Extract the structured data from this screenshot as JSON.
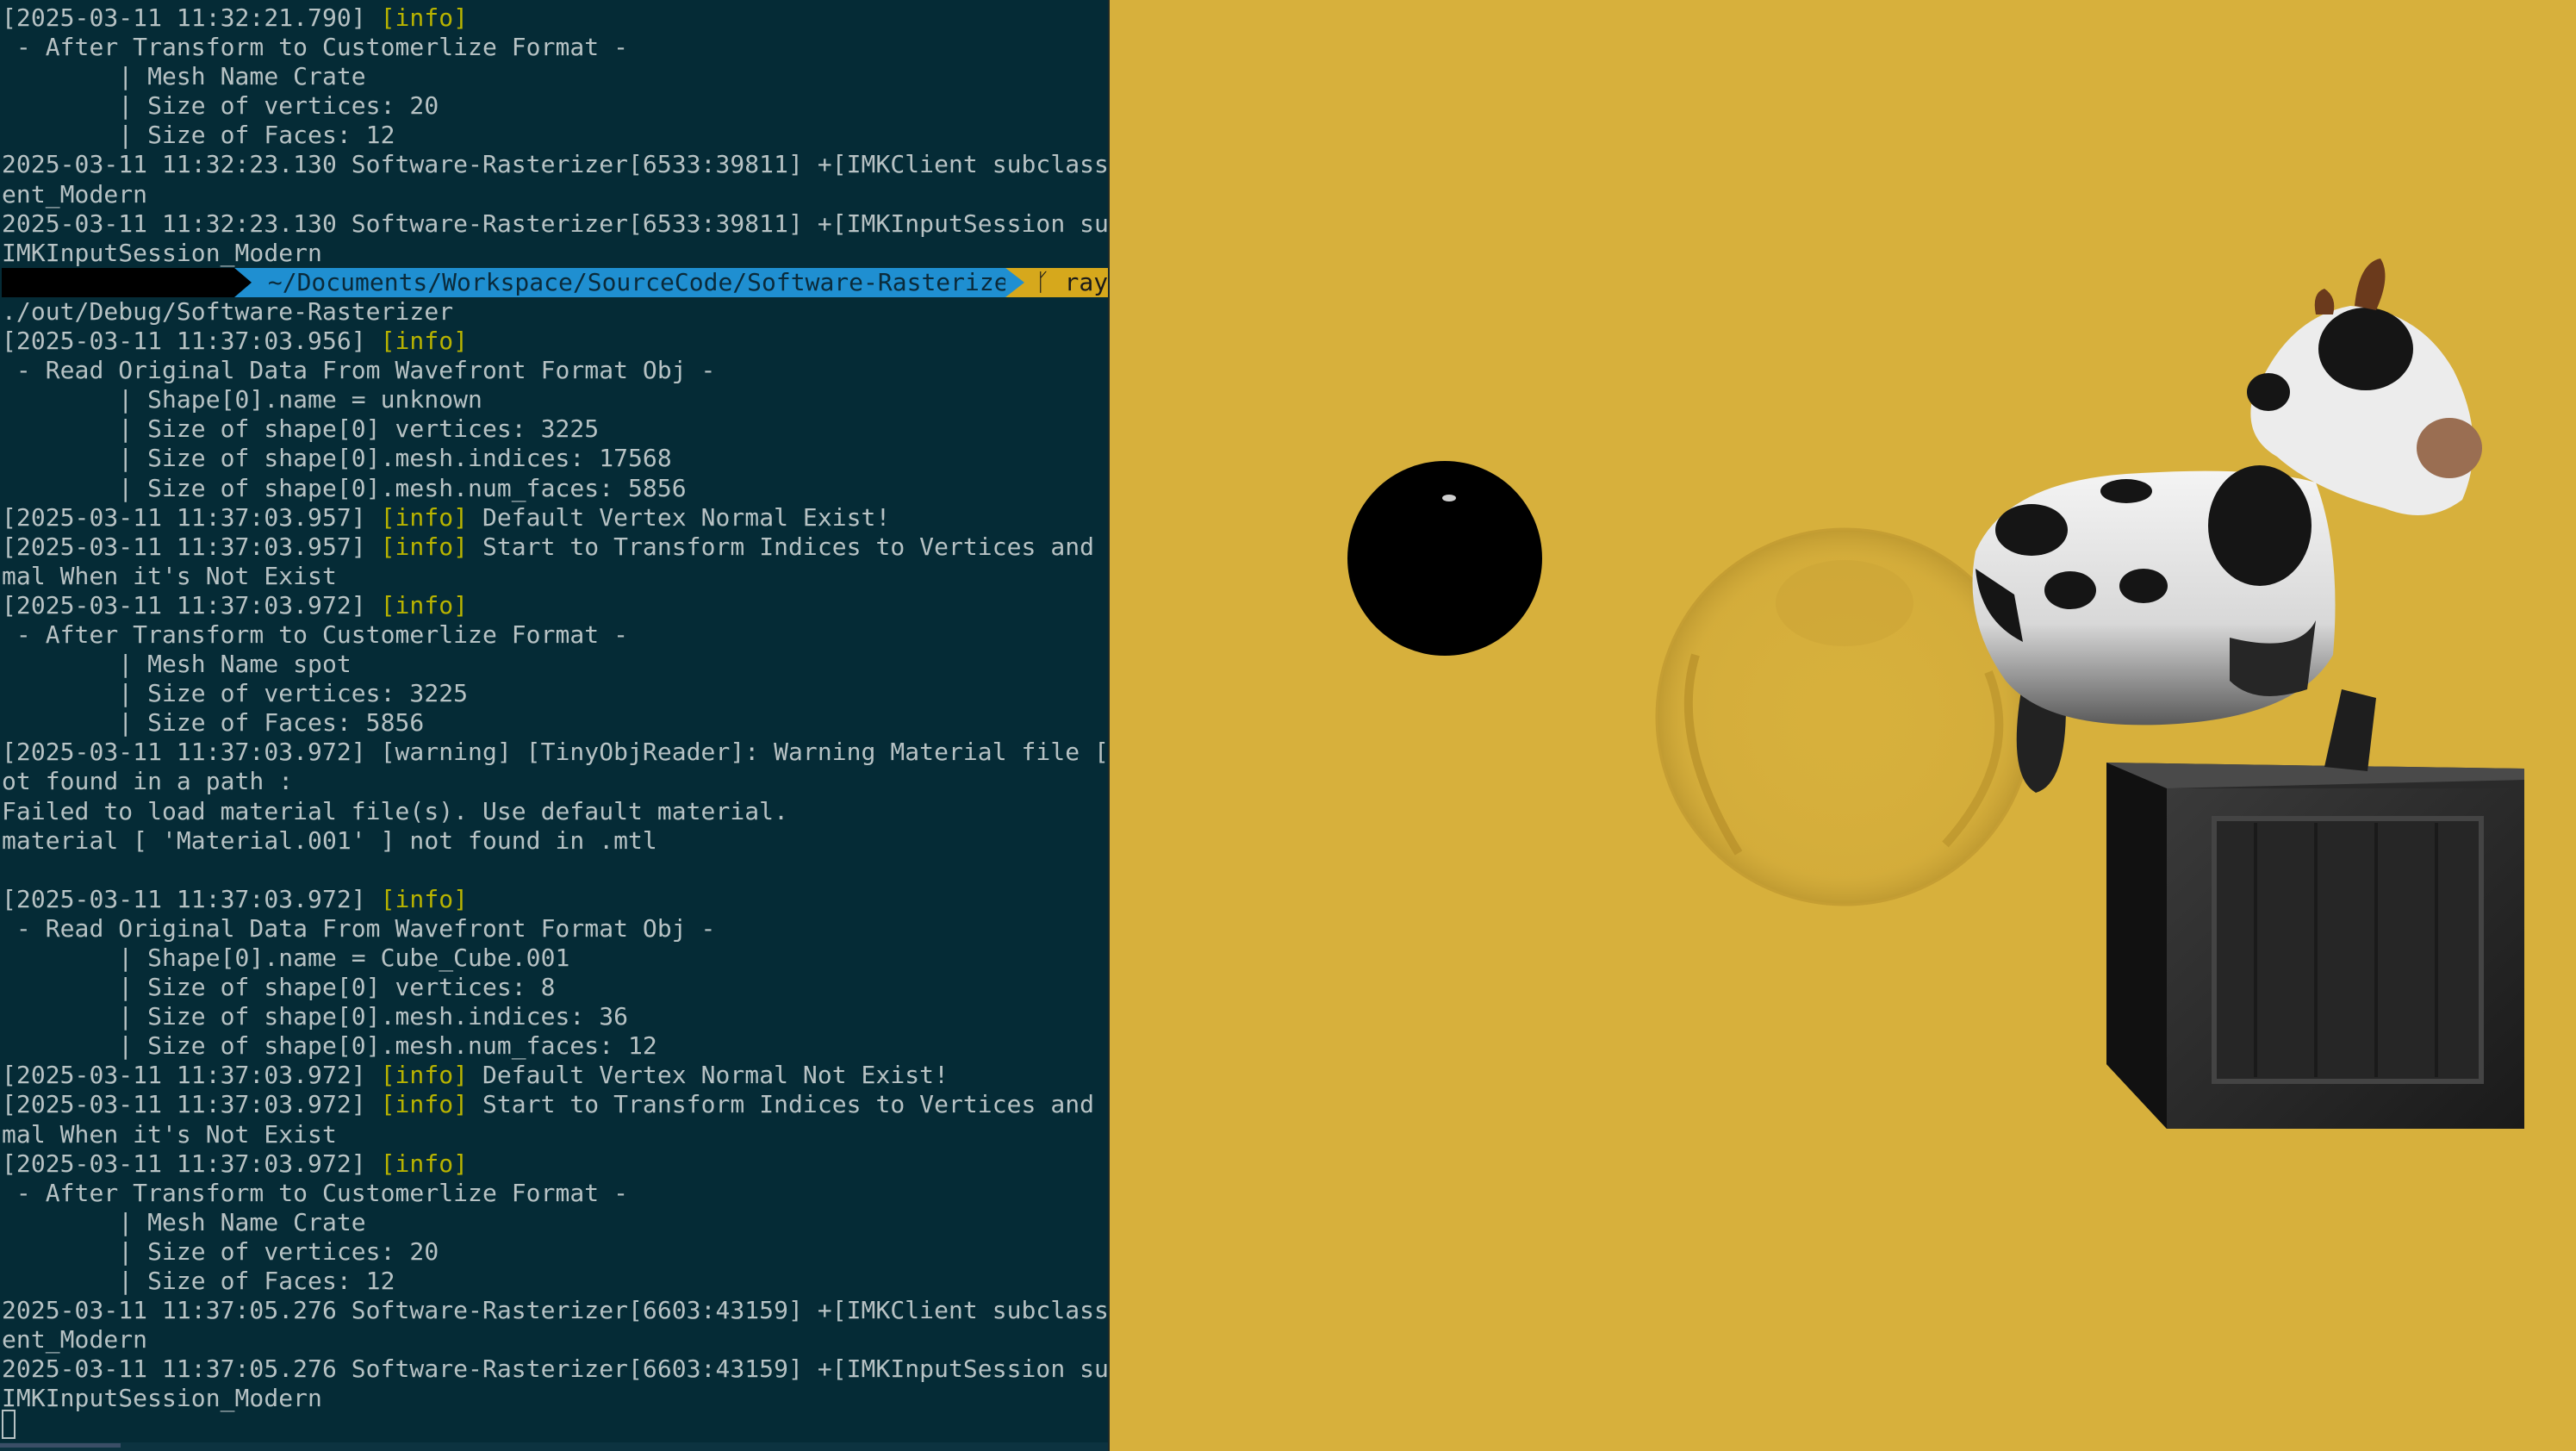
{
  "terminal": {
    "lines_top": [
      {
        "t": "[2025-03-11 11:32:21.790] ",
        "info": "[info]"
      },
      {
        "t": " - After Transform to Customerlize Format -"
      },
      {
        "t": "        | Mesh Name Crate"
      },
      {
        "t": "        | Size of vertices: 20"
      },
      {
        "t": "        | Size of Faces: 12"
      },
      {
        "t": "2025-03-11 11:32:23.130 Software-Rasterizer[6533:39811] +[IMKClient subclass]: ch"
      },
      {
        "t": "ent_Modern"
      },
      {
        "t": "2025-03-11 11:32:23.130 Software-Rasterizer[6533:39811] +[IMKInputSession subcla"
      },
      {
        "t": "IMKInputSession_Modern"
      }
    ],
    "prompt": {
      "path": " ~/Documents/Workspace/SourceCode/Software-Rasterizer ",
      "branch": " ᚴ rayt"
    },
    "lines_bottom": [
      {
        "t": "./out/Debug/Software-Rasterizer"
      },
      {
        "t": "[2025-03-11 11:37:03.956] ",
        "info": "[info]"
      },
      {
        "t": " - Read Original Data From Wavefront Format Obj -"
      },
      {
        "t": "        | Shape[0].name = unknown"
      },
      {
        "t": "        | Size of shape[0] vertices: 3225"
      },
      {
        "t": "        | Size of shape[0].mesh.indices: 17568"
      },
      {
        "t": "        | Size of shape[0].mesh.num_faces: 5856"
      },
      {
        "t": "[2025-03-11 11:37:03.957] ",
        "info": "[info]",
        "rest": " Default Vertex Normal Exist!"
      },
      {
        "t": "[2025-03-11 11:37:03.957] ",
        "info": "[info]",
        "rest": " Start to Transform Indices to Vertices and Calc"
      },
      {
        "t": "mal When it's Not Exist"
      },
      {
        "t": "[2025-03-11 11:37:03.972] ",
        "info": "[info]"
      },
      {
        "t": " - After Transform to Customerlize Format -"
      },
      {
        "t": "        | Mesh Name spot"
      },
      {
        "t": "        | Size of vertices: 3225"
      },
      {
        "t": "        | Size of Faces: 5856"
      },
      {
        "t": "[2025-03-11 11:37:03.972] [warning] [TinyObjReader]: Warning Material file [ Cra"
      },
      {
        "t": "ot found in a path :"
      },
      {
        "t": "Failed to load material file(s). Use default material."
      },
      {
        "t": "material [ 'Material.001' ] not found in .mtl"
      },
      {
        "t": ""
      },
      {
        "t": "[2025-03-11 11:37:03.972] ",
        "info": "[info]"
      },
      {
        "t": " - Read Original Data From Wavefront Format Obj -"
      },
      {
        "t": "        | Shape[0].name = Cube_Cube.001"
      },
      {
        "t": "        | Size of shape[0] vertices: 8"
      },
      {
        "t": "        | Size of shape[0].mesh.indices: 36"
      },
      {
        "t": "        | Size of shape[0].mesh.num_faces: 12"
      },
      {
        "t": "[2025-03-11 11:37:03.972] ",
        "info": "[info]",
        "rest": " Default Vertex Normal Not Exist!"
      },
      {
        "t": "[2025-03-11 11:37:03.972] ",
        "info": "[info]",
        "rest": " Start to Transform Indices to Vertices and Calc"
      },
      {
        "t": "mal When it's Not Exist"
      },
      {
        "t": "[2025-03-11 11:37:03.972] ",
        "info": "[info]"
      },
      {
        "t": " - After Transform to Customerlize Format -"
      },
      {
        "t": "        | Mesh Name Crate"
      },
      {
        "t": "        | Size of vertices: 20"
      },
      {
        "t": "        | Size of Faces: 12"
      },
      {
        "t": "2025-03-11 11:37:05.276 Software-Rasterizer[6603:43159] +[IMKClient subclass]: ch"
      },
      {
        "t": "ent_Modern"
      },
      {
        "t": "2025-03-11 11:37:05.276 Software-Rasterizer[6603:43159] +[IMKInputSession subcla"
      },
      {
        "t": "IMKInputSession_Modern"
      }
    ]
  },
  "colors": {
    "terminal_bg": "#052b36",
    "terminal_text": "#b7c2c4",
    "info_tag": "#b8b300",
    "prompt_host_bg": "#000000",
    "prompt_path_bg": "#1f8fd1",
    "prompt_branch_bg": "#d6a81c",
    "viewport_bg": "#d7b03c"
  },
  "scene": {
    "objects": [
      "black-sphere",
      "glass-sphere",
      "cow-spot",
      "wooden-crate"
    ]
  }
}
